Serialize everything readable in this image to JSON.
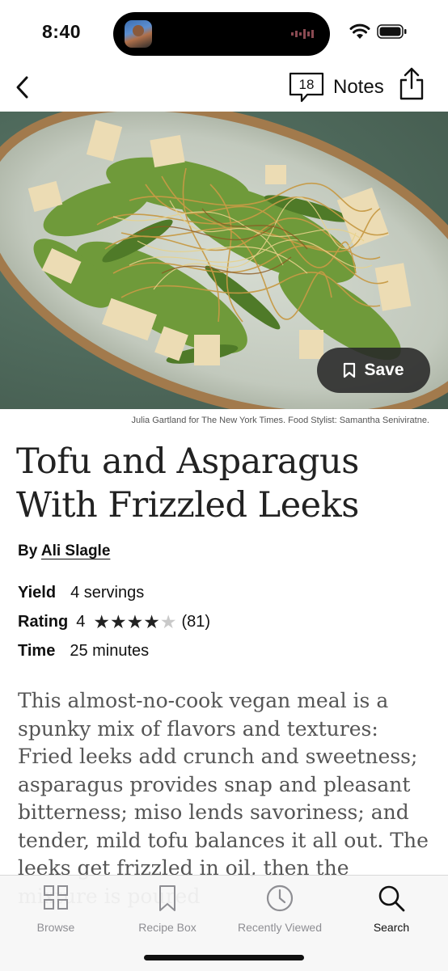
{
  "status_bar": {
    "time": "8:40"
  },
  "nav": {
    "notes_count": "18",
    "notes_label": "Notes"
  },
  "hero": {
    "save_label": "Save",
    "credit": "Julia Gartland for The New York Times. Food Stylist: Samantha Seniviratne."
  },
  "recipe": {
    "title": "Tofu and Asparagus With Frizzled Leeks",
    "by_prefix": "By",
    "author": "Ali Slagle",
    "yield_label": "Yield",
    "yield_value": "4 servings",
    "rating_label": "Rating",
    "rating_value": "4",
    "rating_stars": 4,
    "rating_max": 5,
    "rating_count": "(81)",
    "time_label": "Time",
    "time_value": "25 minutes",
    "description": "This almost-no-cook vegan meal is a spunky mix of flavors and textures: Fried leeks add crunch and sweetness; asparagus provides snap and pleasant bitterness; miso lends savoriness; and tender, mild tofu balances it all out. The leeks get frizzled in oil, then the mixture is poured"
  },
  "tabs": [
    {
      "label": "Browse",
      "icon": "grid-icon",
      "active": false
    },
    {
      "label": "Recipe Box",
      "icon": "bookmark-icon",
      "active": false
    },
    {
      "label": "Recently Viewed",
      "icon": "clock-icon",
      "active": false
    },
    {
      "label": "Search",
      "icon": "search-icon",
      "active": true
    }
  ],
  "colors": {
    "text": "#111111",
    "muted_text": "#555555",
    "tab_inactive": "#8e8e93",
    "save_bg": "#282828"
  }
}
